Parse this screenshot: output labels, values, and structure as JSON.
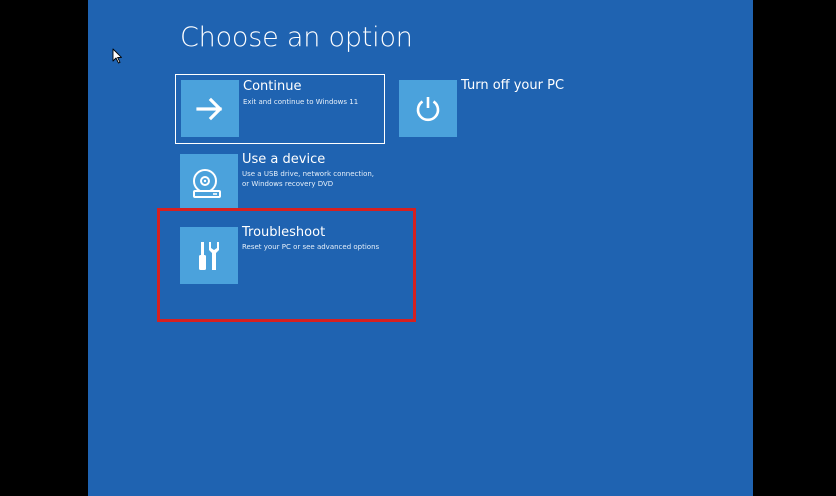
{
  "screen": {
    "title": "Choose an option"
  },
  "options": {
    "continue": {
      "title": "Continue",
      "desc_lines": [
        "Exit and continue to Windows 11"
      ],
      "icon": "arrow-right-icon"
    },
    "turn_off": {
      "title": "Turn off your PC",
      "icon": "power-icon"
    },
    "use_device": {
      "title": "Use a device",
      "desc_lines": [
        "Use a USB drive, network connection,",
        "or Windows recovery DVD"
      ],
      "icon": "disc-drive-icon"
    },
    "troubleshoot": {
      "title": "Troubleshoot",
      "desc_lines": [
        "Reset your PC or see advanced options"
      ],
      "icon": "tools-icon"
    }
  },
  "colors": {
    "background": "#1f63b1",
    "tile": "#4ba2dc",
    "highlight": "#d62020"
  }
}
